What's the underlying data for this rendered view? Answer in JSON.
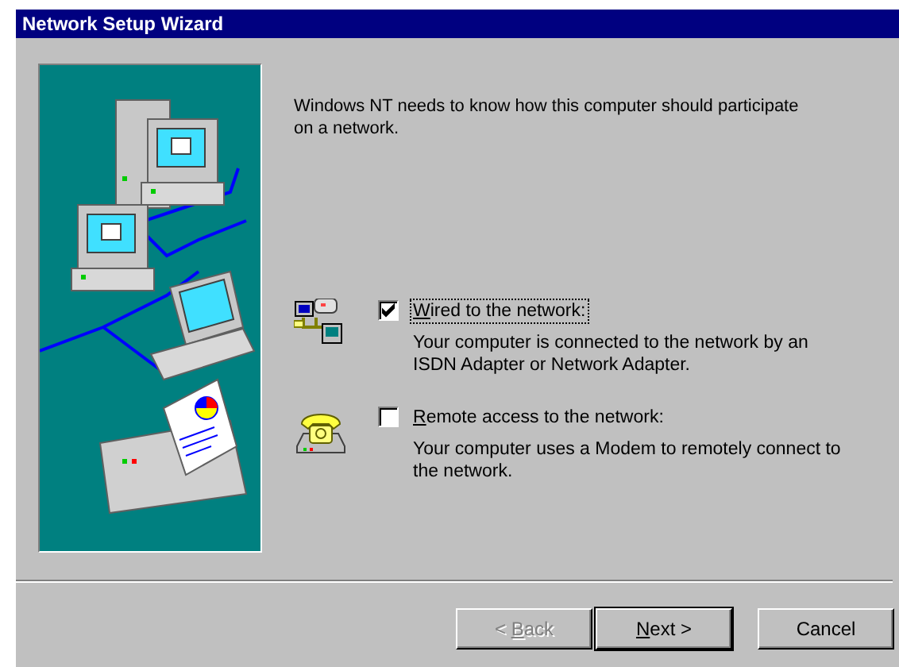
{
  "window": {
    "title": "Network Setup Wizard"
  },
  "intro": "Windows NT needs to know how this computer should participate on a network.",
  "options": [
    {
      "kind": "wired",
      "label": {
        "underlined": "W",
        "after": "ired to the network:"
      },
      "checked": true,
      "focused": true,
      "description": "Your computer is connected to the network by an ISDN Adapter or Network Adapter."
    },
    {
      "kind": "remote",
      "label": {
        "underlined": "R",
        "after": "emote access to the network:"
      },
      "checked": false,
      "focused": false,
      "description": "Your computer uses a Modem to remotely connect to the network."
    }
  ],
  "buttons": [
    {
      "label": {
        "before": "< ",
        "underlined": "B",
        "after": "ack"
      },
      "disabled": true,
      "default": false
    },
    {
      "label": {
        "underlined": "N",
        "after": "ext >"
      },
      "disabled": false,
      "default": true
    },
    {
      "label": {
        "after": "Cancel"
      },
      "disabled": false,
      "default": false
    }
  ]
}
